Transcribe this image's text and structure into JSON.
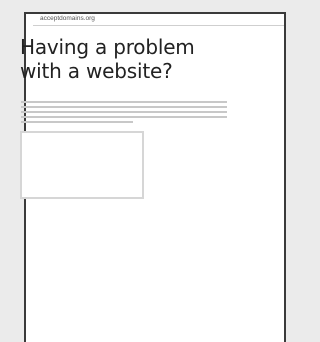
{
  "browser": {
    "url": "acceptdomains.org"
  },
  "page": {
    "headline": "Having a problem with a website?"
  }
}
